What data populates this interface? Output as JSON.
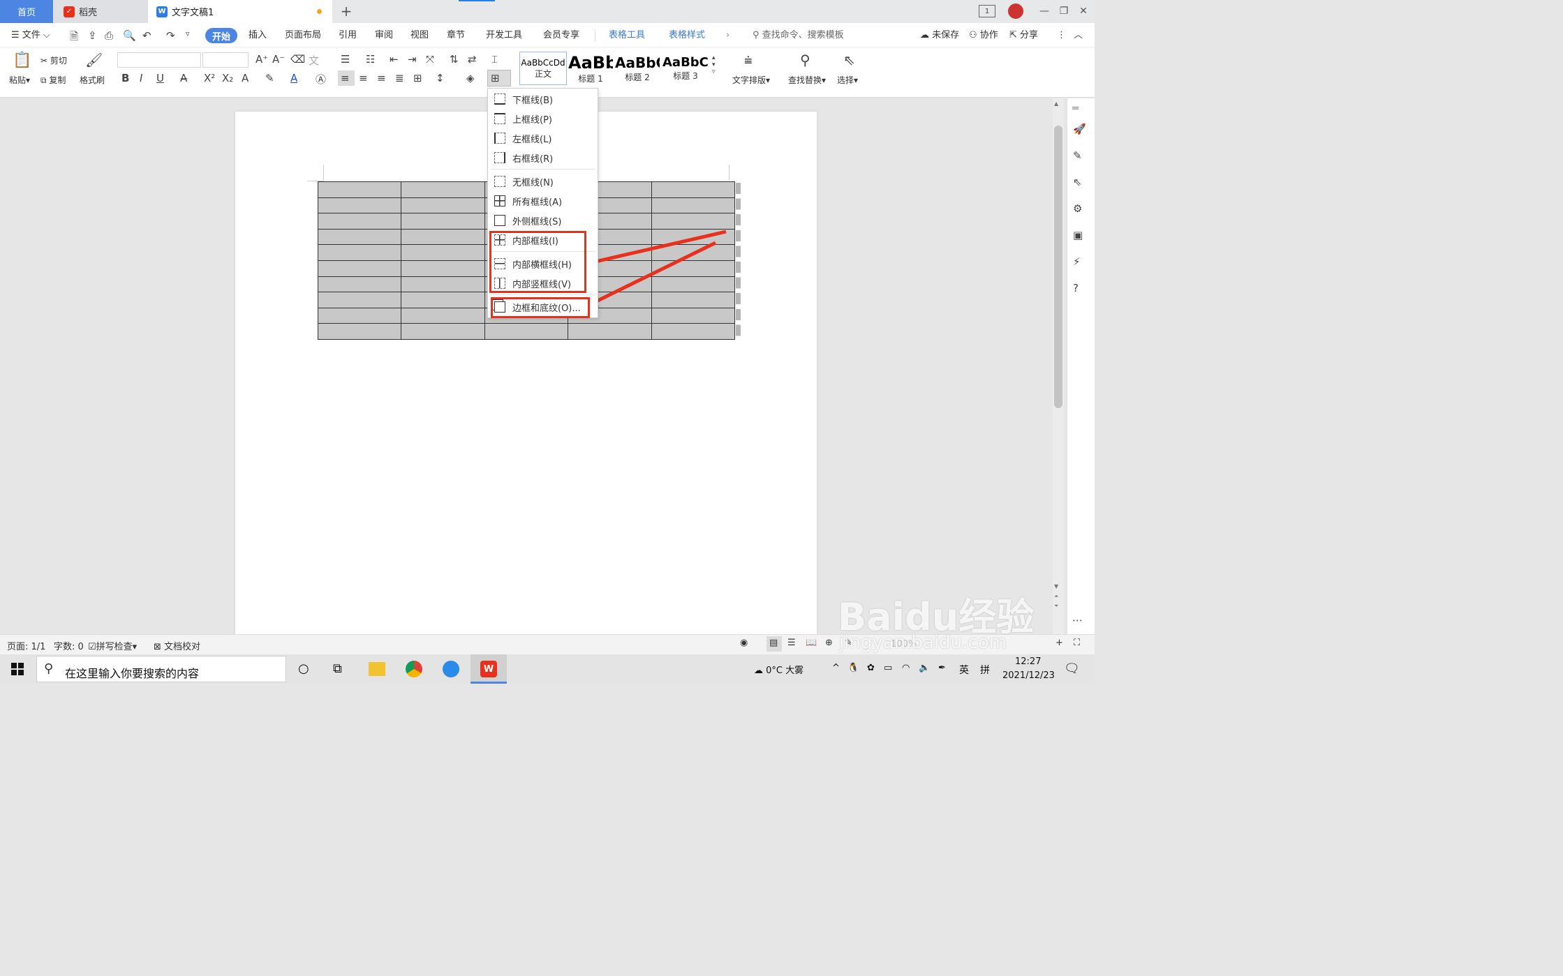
{
  "tabs": {
    "home": "首页",
    "daoke": "稻壳",
    "doc": "文字文稿1",
    "add": "+"
  },
  "window": {
    "layout_badge": "1"
  },
  "menubar": {
    "file": "文件",
    "items": [
      "开始",
      "插入",
      "页面布局",
      "引用",
      "审阅",
      "视图",
      "章节",
      "开发工具",
      "会员专享"
    ],
    "table_tools": "表格工具",
    "table_style": "表格样式",
    "search_placeholder": "查找命令、搜索模板",
    "unsaved": "未保存",
    "collab": "协作",
    "share": "分享"
  },
  "ribbon": {
    "paste": "粘贴",
    "cut": "剪切",
    "copy": "复制",
    "format_painter": "格式刷",
    "styles": [
      {
        "preview": "AaBbCcDd",
        "label": "正文"
      },
      {
        "preview": "AaBb",
        "label": "标题 1"
      },
      {
        "preview": "AaBbC",
        "label": "标题 2"
      },
      {
        "preview": "AaBbC",
        "label": "标题 3"
      }
    ],
    "text_layout": "文字排版",
    "find_replace": "查找替换",
    "select": "选择"
  },
  "dropdown": {
    "items": [
      "下框线(B)",
      "上框线(P)",
      "左框线(L)",
      "右框线(R)",
      "无框线(N)",
      "所有框线(A)",
      "外侧框线(S)",
      "内部框线(I)",
      "内部横框线(H)",
      "内部竖框线(V)",
      "边框和底纹(O)..."
    ]
  },
  "table": {
    "rows": 10,
    "cols": 5
  },
  "statusbar": {
    "page": "页面: 1/1",
    "words": "字数: 0",
    "spell": "拼写检查",
    "proof": "文档校对",
    "zoom": "100%"
  },
  "taskbar": {
    "search_placeholder": "在这里输入你要搜索的内容",
    "weather": "0°C 大雾",
    "ime1": "英",
    "ime2": "拼",
    "time": "12:27",
    "date": "2021/12/23"
  },
  "watermark": {
    "text": "Baidu经验",
    "url": "jingyan.baidu.com"
  },
  "colors": {
    "accent": "#4c86e2",
    "annotation_red": "#e8301c",
    "table_fill": "#c8c8c8"
  }
}
